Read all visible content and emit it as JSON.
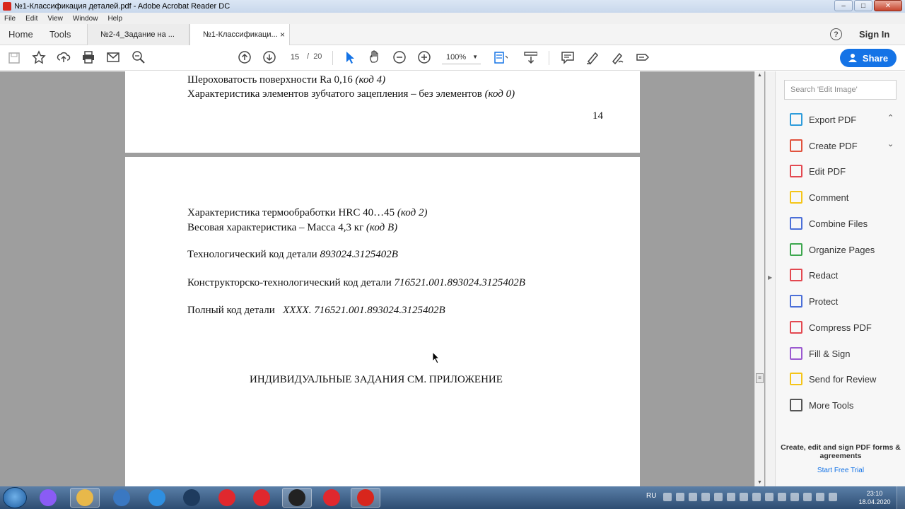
{
  "window": {
    "title": "№1-Классификация деталей.pdf - Adobe Acrobat Reader DC",
    "buttons": {
      "minimize": "–",
      "maximize": "□",
      "close": "✕"
    }
  },
  "menu": [
    "File",
    "Edit",
    "View",
    "Window",
    "Help"
  ],
  "tabs": {
    "home": "Home",
    "tools": "Tools",
    "documents": [
      {
        "label": "№2-4_Задание на ...",
        "active": false
      },
      {
        "label": "№1-Классификаци...",
        "active": true,
        "close": "×"
      }
    ],
    "help": "?",
    "sign_in": "Sign In"
  },
  "toolbar": {
    "icons": [
      "save-icon",
      "star-icon",
      "upload-icon",
      "print-icon",
      "email-icon",
      "search-zoom-icon",
      "page-up-icon",
      "page-down-icon",
      "select-cursor-icon",
      "hand-icon",
      "zoom-out-icon",
      "zoom-in-icon",
      "fit-page-icon",
      "scroll-mode-icon",
      "comment-icon",
      "highlight-pen-icon",
      "sign-icon",
      "more-share-icon"
    ],
    "page_current": "15",
    "page_sep": "/",
    "page_total": "20",
    "zoom": "100%",
    "zoom_caret": "▼",
    "share": "Share"
  },
  "document": {
    "page1": {
      "line_partial": "Шероховатость поверхности Ra 0,16",
      "line_partial_code": "(код 4)",
      "line2": "Характеристика элементов зубчатого зацепления – без элементов",
      "line2_code": "(код 0)",
      "page_number": "14"
    },
    "page2": {
      "line1": "Характеристика термообработки HRC 40…45",
      "line1_code": "(код 2)",
      "line2": "Весовая характеристика – Масса 4,3 кг",
      "line2_code": "(код В)",
      "line3": "Технологический код детали",
      "line3_code": "893024.3125402В",
      "line4": "Конструкторско-технологический код детали",
      "line4_code": "716521.001.893024.3125402В",
      "line5": "Полный код детали",
      "line5_code": "XXXX. 716521.001.893024.3125402В",
      "heading": "ИНДИВИДУАЛЬНЫЕ ЗАДАНИЯ СМ. ПРИЛОЖЕНИЕ"
    }
  },
  "tool_pane": {
    "search_placeholder": "Search 'Edit Image'",
    "items": [
      {
        "label": "Export PDF",
        "icon": "export-pdf-icon",
        "color": "#2d9cdb",
        "chevron": "⌃"
      },
      {
        "label": "Create PDF",
        "icon": "create-pdf-icon",
        "color": "#e1523d",
        "chevron": "⌄"
      },
      {
        "label": "Edit PDF",
        "icon": "edit-pdf-icon",
        "color": "#e34850"
      },
      {
        "label": "Comment",
        "icon": "comment-icon",
        "color": "#f5c518"
      },
      {
        "label": "Combine Files",
        "icon": "combine-files-icon",
        "color": "#4b6fd8"
      },
      {
        "label": "Organize Pages",
        "icon": "organize-pages-icon",
        "color": "#3da74e"
      },
      {
        "label": "Redact",
        "icon": "redact-icon",
        "color": "#e34850"
      },
      {
        "label": "Protect",
        "icon": "protect-icon",
        "color": "#4b6fd8"
      },
      {
        "label": "Compress PDF",
        "icon": "compress-pdf-icon",
        "color": "#e34850"
      },
      {
        "label": "Fill & Sign",
        "icon": "fill-sign-icon",
        "color": "#9b59d0"
      },
      {
        "label": "Send for Review",
        "icon": "send-review-icon",
        "color": "#f5c518"
      },
      {
        "label": "More Tools",
        "icon": "more-tools-icon",
        "color": "#555555"
      }
    ],
    "promo": "Create, edit and sign PDF forms & agreements",
    "trial": "Start Free Trial"
  },
  "taskbar": {
    "apps": [
      {
        "name": "alice-app",
        "color": "#8a5cf5"
      },
      {
        "name": "file-explorer",
        "color": "#e8b84a"
      },
      {
        "name": "control-panel",
        "color": "#3a78c2"
      },
      {
        "name": "internet-explorer",
        "color": "#2f8fe0"
      },
      {
        "name": "obs-like-app",
        "color": "#1e3b5e"
      },
      {
        "name": "opera",
        "color": "#e0282e"
      },
      {
        "name": "yandex-app",
        "color": "#e0282e"
      },
      {
        "name": "obs-studio",
        "color": "#222222"
      },
      {
        "name": "yandex-browser",
        "color": "#e0282e"
      },
      {
        "name": "acrobat-reader",
        "color": "#d8261c"
      }
    ],
    "lang": "RU",
    "time": "23:10",
    "date": "18.04.2020"
  }
}
